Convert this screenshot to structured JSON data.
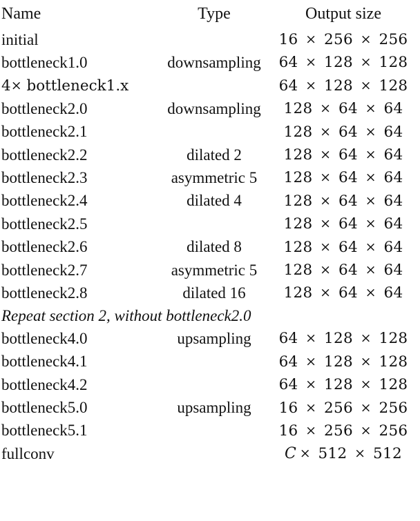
{
  "table": {
    "columns": [
      {
        "key": "name",
        "label": "Name",
        "align": "left"
      },
      {
        "key": "type",
        "label": "Type",
        "align": "center"
      },
      {
        "key": "output",
        "label": "Output size",
        "align": "center"
      }
    ],
    "sections": [
      {
        "id": "section-initial",
        "rows": [
          {
            "name": "initial",
            "type": "",
            "output": "16 × 256 × 256"
          }
        ]
      },
      {
        "id": "section-1",
        "rows": [
          {
            "name": "bottleneck1.0",
            "type": "downsampling",
            "output": "64 × 128 × 128"
          },
          {
            "name": "4× bottleneck1.x",
            "type": "",
            "output": "64 × 128 × 128"
          }
        ]
      },
      {
        "id": "section-2",
        "rows": [
          {
            "name": "bottleneck2.0",
            "type": "downsampling",
            "output": "128 × 64 × 64"
          },
          {
            "name": "bottleneck2.1",
            "type": "",
            "output": "128 × 64 × 64"
          },
          {
            "name": "bottleneck2.2",
            "type": "dilated 2",
            "output": "128 × 64 × 64"
          },
          {
            "name": "bottleneck2.3",
            "type": "asymmetric 5",
            "output": "128 × 64 × 64"
          },
          {
            "name": "bottleneck2.4",
            "type": "dilated 4",
            "output": "128 × 64 × 64"
          },
          {
            "name": "bottleneck2.5",
            "type": "",
            "output": "128 × 64 × 64"
          },
          {
            "name": "bottleneck2.6",
            "type": "dilated 8",
            "output": "128 × 64 × 64"
          },
          {
            "name": "bottleneck2.7",
            "type": "asymmetric 5",
            "output": "128 × 64 × 64"
          },
          {
            "name": "bottleneck2.8",
            "type": "dilated 16",
            "output": "128 × 64 × 64"
          }
        ]
      },
      {
        "id": "section-3-note",
        "note": "Repeat section 2, without bottleneck2.0",
        "rows": []
      },
      {
        "id": "section-4",
        "rows": [
          {
            "name": "bottleneck4.0",
            "type": "upsampling",
            "output": "64 × 128 × 128"
          },
          {
            "name": "bottleneck4.1",
            "type": "",
            "output": "64 × 128 × 128"
          },
          {
            "name": "bottleneck4.2",
            "type": "",
            "output": "64 × 128 × 128"
          }
        ]
      },
      {
        "id": "section-5",
        "rows": [
          {
            "name": "bottleneck5.0",
            "type": "upsampling",
            "output": "16 × 256 × 256"
          },
          {
            "name": "bottleneck5.1",
            "type": "",
            "output": "16 × 256 × 256"
          }
        ]
      },
      {
        "id": "section-fullconv",
        "rows": [
          {
            "name": "fullconv",
            "type": "",
            "output": "C × 512 × 512"
          }
        ]
      }
    ]
  },
  "style": {
    "background": "#ffffff",
    "text_color": "#111111",
    "rule_color": "#000000"
  }
}
